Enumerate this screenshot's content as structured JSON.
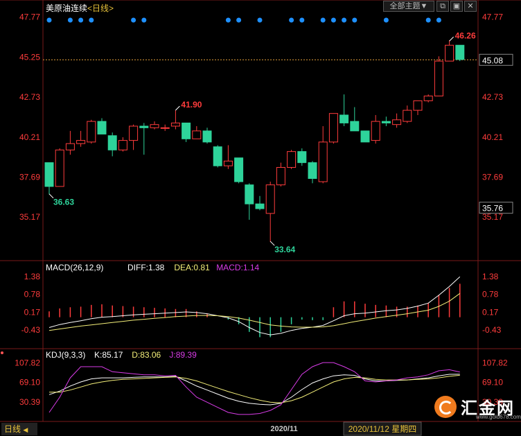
{
  "header": {
    "instrument": "美原油连续",
    "period": "<日线>",
    "theme_button": "全部主题▼"
  },
  "window_buttons": [
    "⧉",
    "▣",
    "✕"
  ],
  "bottom": {
    "tab": "日线",
    "tab_arrow": "◀",
    "date_axis_label": "2020/11",
    "cursor_date": "2020/11/12 星期四"
  },
  "logo": {
    "name": "汇金网",
    "url": "www.gold678.com"
  },
  "colors": {
    "up": "#ff3c3c",
    "down": "#2ed39a",
    "axis_red": "#ff3c3c",
    "diff": "#ffffff",
    "dea": "#f5f07a",
    "macd": "#d93ce8",
    "dots": "#1e90ff"
  },
  "chart_data": [
    {
      "type": "candlestick",
      "title": "美原油连续 日线",
      "y_ticks": [
        "47.77",
        "45.25",
        "42.73",
        "40.21",
        "37.69",
        "35.17"
      ],
      "ylim": [
        32.6,
        48.5
      ],
      "last_price": "45.08",
      "right_extra_label": "35.76",
      "annotations": [
        {
          "text": "41.90",
          "index": 12,
          "value": 41.9,
          "kind": "high"
        },
        {
          "text": "36.63",
          "index": 0,
          "value": 36.63,
          "kind": "low"
        },
        {
          "text": "33.64",
          "index": 21,
          "value": 33.64,
          "kind": "low"
        },
        {
          "text": "46.26",
          "index": 38,
          "value": 46.26,
          "kind": "high"
        }
      ],
      "signal_dot_indices": [
        0,
        2,
        3,
        4,
        8,
        9,
        17,
        18,
        20,
        23,
        24,
        26,
        27,
        28,
        29,
        32,
        36,
        37
      ],
      "candles": [
        {
          "o": 38.6,
          "h": 38.6,
          "l": 36.6,
          "c": 37.1
        },
        {
          "o": 37.1,
          "h": 39.5,
          "l": 37.1,
          "c": 39.4
        },
        {
          "o": 39.4,
          "h": 40.6,
          "l": 39.1,
          "c": 39.8
        },
        {
          "o": 39.8,
          "h": 40.6,
          "l": 39.6,
          "c": 40.0
        },
        {
          "o": 39.9,
          "h": 41.3,
          "l": 39.8,
          "c": 41.2
        },
        {
          "o": 41.2,
          "h": 41.4,
          "l": 40.4,
          "c": 40.4
        },
        {
          "o": 40.3,
          "h": 40.5,
          "l": 39.0,
          "c": 39.4
        },
        {
          "o": 39.4,
          "h": 40.2,
          "l": 39.3,
          "c": 40.0
        },
        {
          "o": 40.0,
          "h": 41.0,
          "l": 39.4,
          "c": 40.9
        },
        {
          "o": 40.9,
          "h": 41.1,
          "l": 39.1,
          "c": 40.8
        },
        {
          "o": 40.8,
          "h": 41.2,
          "l": 40.7,
          "c": 41.0
        },
        {
          "o": 40.8,
          "h": 41.0,
          "l": 40.6,
          "c": 40.8
        },
        {
          "o": 40.9,
          "h": 41.9,
          "l": 40.7,
          "c": 41.1
        },
        {
          "o": 41.1,
          "h": 41.1,
          "l": 39.9,
          "c": 40.1
        },
        {
          "o": 40.1,
          "h": 40.9,
          "l": 40.1,
          "c": 40.6
        },
        {
          "o": 40.6,
          "h": 40.8,
          "l": 39.8,
          "c": 39.9
        },
        {
          "o": 39.6,
          "h": 39.7,
          "l": 38.3,
          "c": 38.4
        },
        {
          "o": 38.4,
          "h": 39.7,
          "l": 38.2,
          "c": 38.7
        },
        {
          "o": 38.9,
          "h": 38.9,
          "l": 37.3,
          "c": 37.4
        },
        {
          "o": 37.2,
          "h": 37.3,
          "l": 35.0,
          "c": 36.0
        },
        {
          "o": 36.0,
          "h": 36.5,
          "l": 35.6,
          "c": 35.7
        },
        {
          "o": 35.4,
          "h": 37.4,
          "l": 33.6,
          "c": 37.2
        },
        {
          "o": 37.2,
          "h": 38.6,
          "l": 37.1,
          "c": 38.3
        },
        {
          "o": 38.3,
          "h": 39.4,
          "l": 38.2,
          "c": 39.3
        },
        {
          "o": 39.3,
          "h": 39.5,
          "l": 38.4,
          "c": 38.6
        },
        {
          "o": 38.6,
          "h": 38.7,
          "l": 37.3,
          "c": 37.6
        },
        {
          "o": 37.4,
          "h": 40.9,
          "l": 37.3,
          "c": 39.9
        },
        {
          "o": 39.9,
          "h": 41.7,
          "l": 39.8,
          "c": 41.7
        },
        {
          "o": 41.6,
          "h": 42.9,
          "l": 40.9,
          "c": 41.1
        },
        {
          "o": 41.2,
          "h": 42.1,
          "l": 40.6,
          "c": 40.6
        },
        {
          "o": 40.6,
          "h": 40.6,
          "l": 39.9,
          "c": 39.9
        },
        {
          "o": 40.0,
          "h": 41.6,
          "l": 39.8,
          "c": 41.2
        },
        {
          "o": 41.2,
          "h": 41.5,
          "l": 40.9,
          "c": 41.1
        },
        {
          "o": 41.0,
          "h": 41.7,
          "l": 40.8,
          "c": 41.3
        },
        {
          "o": 41.2,
          "h": 42.2,
          "l": 41.1,
          "c": 41.9
        },
        {
          "o": 41.9,
          "h": 42.5,
          "l": 41.6,
          "c": 42.5
        },
        {
          "o": 42.5,
          "h": 42.9,
          "l": 42.4,
          "c": 42.8
        },
        {
          "o": 42.8,
          "h": 45.3,
          "l": 42.8,
          "c": 45.0
        },
        {
          "o": 45.0,
          "h": 46.3,
          "l": 45.0,
          "c": 46.0
        },
        {
          "o": 46.0,
          "h": 46.0,
          "l": 45.0,
          "c": 45.1
        }
      ]
    },
    {
      "type": "line",
      "title": "MACD(26,12,9)",
      "legend": [
        {
          "name": "DIFF",
          "value": "1.38"
        },
        {
          "name": "DEA",
          "value": "0.81"
        },
        {
          "name": "MACD",
          "value": "1.14"
        }
      ],
      "y_ticks": [
        "1.38",
        "0.78",
        "0.17",
        "-0.43"
      ],
      "ylim": [
        -1.0,
        1.55
      ],
      "series": [
        {
          "name": "DIFF",
          "values": [
            -0.35,
            -0.25,
            -0.18,
            -0.12,
            -0.05,
            0.0,
            0.02,
            0.05,
            0.08,
            0.1,
            0.12,
            0.14,
            0.16,
            0.18,
            0.16,
            0.12,
            0.05,
            -0.02,
            -0.15,
            -0.35,
            -0.52,
            -0.6,
            -0.55,
            -0.45,
            -0.38,
            -0.34,
            -0.28,
            -0.12,
            0.05,
            0.12,
            0.14,
            0.18,
            0.22,
            0.25,
            0.3,
            0.38,
            0.48,
            0.75,
            1.05,
            1.38
          ]
        },
        {
          "name": "DEA",
          "values": [
            -0.45,
            -0.4,
            -0.35,
            -0.3,
            -0.26,
            -0.22,
            -0.18,
            -0.14,
            -0.1,
            -0.07,
            -0.04,
            -0.01,
            0.02,
            0.04,
            0.06,
            0.06,
            0.05,
            0.02,
            -0.03,
            -0.1,
            -0.18,
            -0.26,
            -0.3,
            -0.33,
            -0.34,
            -0.34,
            -0.33,
            -0.29,
            -0.22,
            -0.15,
            -0.09,
            -0.03,
            0.02,
            0.07,
            0.12,
            0.18,
            0.24,
            0.37,
            0.55,
            0.81
          ]
        },
        {
          "name": "MACD",
          "values": [
            0.2,
            0.3,
            0.34,
            0.36,
            0.42,
            0.44,
            0.4,
            0.38,
            0.36,
            0.34,
            0.32,
            0.3,
            0.28,
            0.28,
            0.2,
            0.12,
            0.0,
            -0.08,
            -0.24,
            -0.5,
            -0.68,
            -0.68,
            -0.5,
            -0.24,
            -0.08,
            -0.1,
            -0.1,
            0.34,
            0.54,
            0.54,
            0.46,
            0.42,
            0.4,
            0.36,
            0.36,
            0.4,
            0.48,
            0.76,
            1.0,
            1.14
          ]
        }
      ]
    },
    {
      "type": "line",
      "title": "KDJ(9,3,3)",
      "legend": [
        {
          "name": "K",
          "value": "85.17"
        },
        {
          "name": "D",
          "value": "83.06"
        },
        {
          "name": "J",
          "value": "89.39"
        }
      ],
      "y_ticks": [
        "107.82",
        "69.10",
        "30.39"
      ],
      "ylim": [
        -5,
        115
      ],
      "series": [
        {
          "name": "K",
          "values": [
            45,
            52,
            62,
            70,
            76,
            78,
            78,
            78,
            79,
            80,
            80,
            80,
            81,
            72,
            62,
            54,
            46,
            38,
            32,
            28,
            26,
            25,
            28,
            40,
            55,
            68,
            76,
            82,
            84,
            83,
            76,
            72,
            72,
            73,
            74,
            76,
            78,
            82,
            85,
            85.17
          ]
        },
        {
          "name": "D",
          "values": [
            50,
            50,
            54,
            60,
            66,
            70,
            73,
            75,
            76,
            77,
            78,
            79,
            80,
            77,
            72,
            65,
            58,
            51,
            45,
            39,
            34,
            30,
            29,
            33,
            40,
            50,
            60,
            70,
            76,
            79,
            78,
            75,
            74,
            74,
            74,
            75,
            76,
            78,
            81,
            83.06
          ]
        },
        {
          "name": "J",
          "values": [
            10,
            40,
            78,
            100,
            100,
            100,
            90,
            88,
            86,
            84,
            84,
            82,
            83,
            60,
            40,
            30,
            20,
            10,
            6,
            6,
            8,
            14,
            25,
            55,
            85,
            100,
            108,
            108,
            100,
            90,
            72,
            70,
            72,
            74,
            78,
            80,
            84,
            92,
            94,
            89.39
          ]
        }
      ]
    }
  ]
}
